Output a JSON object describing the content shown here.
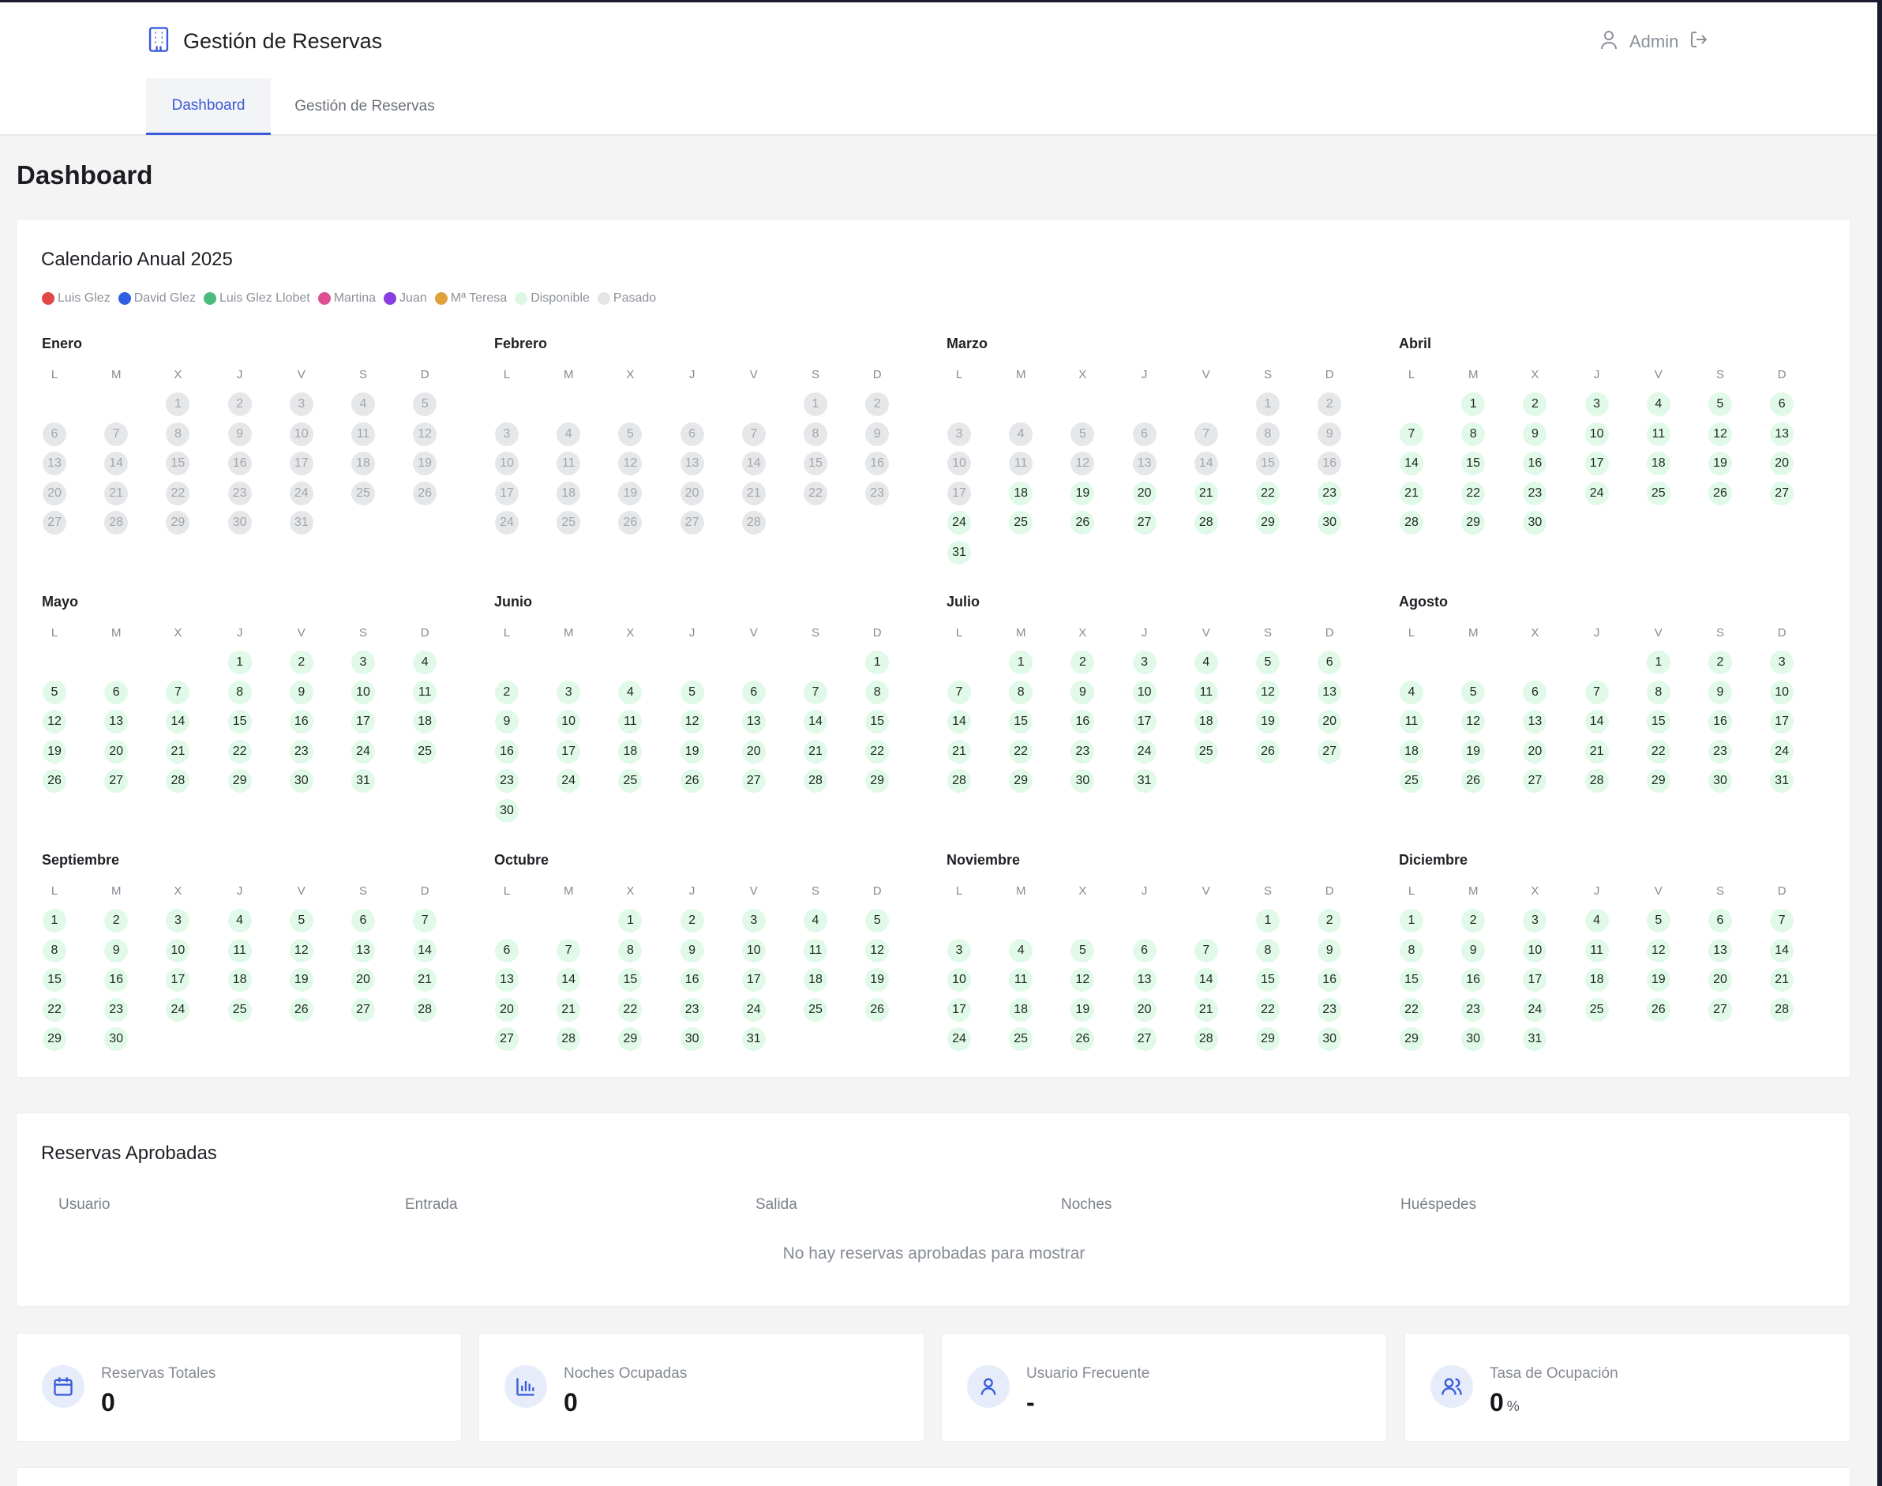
{
  "header": {
    "app_title": "Gestión de Reservas",
    "user_label": "Admin",
    "tabs": [
      {
        "label": "Dashboard",
        "active": true
      },
      {
        "label": "Gestión de Reservas",
        "active": false
      }
    ]
  },
  "page_title": "Dashboard",
  "calendar": {
    "title": "Calendario Anual 2025",
    "legend": [
      {
        "label": "Luis Glez",
        "color": "#e04848"
      },
      {
        "label": "David Glez",
        "color": "#2f5fe0"
      },
      {
        "label": "Luis Glez Llobet",
        "color": "#4dbb7c"
      },
      {
        "label": "Martina",
        "color": "#dc4f93"
      },
      {
        "label": "Juan",
        "color": "#8a3de0"
      },
      {
        "label": "Mª Teresa",
        "color": "#e0a23a"
      },
      {
        "label": "Disponible",
        "color": "#dcf7e4"
      },
      {
        "label": "Pasado",
        "color": "#e4e5e7"
      }
    ],
    "weekdays": [
      "L",
      "M",
      "X",
      "J",
      "V",
      "S",
      "D"
    ],
    "months": [
      {
        "name": "Enero",
        "offset": 2,
        "days": 31,
        "past_until": 31
      },
      {
        "name": "Febrero",
        "offset": 5,
        "days": 28,
        "past_until": 28
      },
      {
        "name": "Marzo",
        "offset": 5,
        "days": 31,
        "past_until": 17
      },
      {
        "name": "Abril",
        "offset": 1,
        "days": 30,
        "past_until": 0
      },
      {
        "name": "Mayo",
        "offset": 3,
        "days": 31,
        "past_until": 0
      },
      {
        "name": "Junio",
        "offset": 6,
        "days": 30,
        "past_until": 0
      },
      {
        "name": "Julio",
        "offset": 1,
        "days": 31,
        "past_until": 0
      },
      {
        "name": "Agosto",
        "offset": 4,
        "days": 31,
        "past_until": 0
      },
      {
        "name": "Septiembre",
        "offset": 0,
        "days": 30,
        "past_until": 0
      },
      {
        "name": "Octubre",
        "offset": 2,
        "days": 31,
        "past_until": 0
      },
      {
        "name": "Noviembre",
        "offset": 5,
        "days": 30,
        "past_until": 0
      },
      {
        "name": "Diciembre",
        "offset": 0,
        "days": 31,
        "past_until": 0
      }
    ]
  },
  "reservas": {
    "title": "Reservas Aprobadas",
    "columns": [
      "Usuario",
      "Entrada",
      "Salida",
      "Noches",
      "Huéspedes"
    ],
    "empty_text": "No hay reservas aprobadas para mostrar"
  },
  "stats": [
    {
      "label": "Reservas Totales",
      "value": "0",
      "suffix": "",
      "icon": "calendar-icon"
    },
    {
      "label": "Noches Ocupadas",
      "value": "0",
      "suffix": "",
      "icon": "bar-chart-icon"
    },
    {
      "label": "Usuario Frecuente",
      "value": "-",
      "suffix": "",
      "icon": "user-icon"
    },
    {
      "label": "Tasa de Ocupación",
      "value": "0",
      "suffix": "%",
      "icon": "users-icon"
    }
  ]
}
